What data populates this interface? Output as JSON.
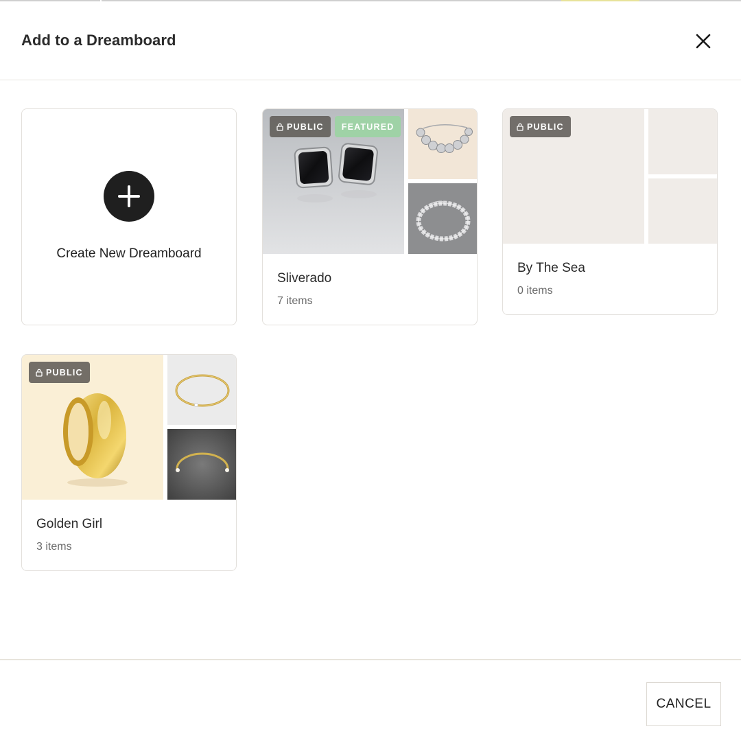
{
  "dialog": {
    "title": "Add to a Dreamboard",
    "close_icon": "close-icon"
  },
  "create": {
    "label": "Create New Dreamboard",
    "icon": "plus-icon"
  },
  "boards": [
    {
      "name": "Sliverado",
      "count": "7 items",
      "badges": [
        "PUBLIC",
        "FEATURED"
      ],
      "images": [
        "black-stud-earrings",
        "silver-bead-bracelet",
        "silver-bead-bracelet-chain"
      ]
    },
    {
      "name": "By The Sea",
      "count": "0 items",
      "badges": [
        "PUBLIC"
      ],
      "images": [
        "empty",
        "empty",
        "empty"
      ]
    },
    {
      "name": "Golden Girl",
      "count": "3 items",
      "badges": [
        "PUBLIC"
      ],
      "images": [
        "gold-ring",
        "gold-tennis-bangle",
        "gold-pearl-cuff"
      ]
    }
  ],
  "footer": {
    "cancel_label": "CANCEL"
  },
  "colors": {
    "placeholder": "#f0ece8",
    "public_badge": "#605c58",
    "featured_badge": "#9fd2a6",
    "dark_button": "#1f1f1f"
  }
}
